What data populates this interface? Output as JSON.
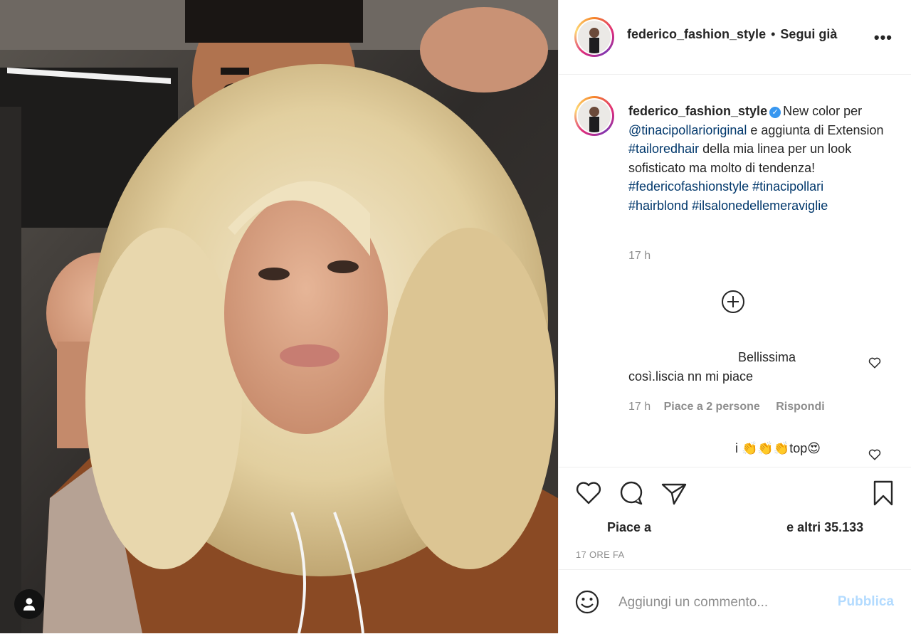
{
  "post": {
    "username": "federico_fashion_style",
    "follow_status": "Segui già",
    "header_separator": "•",
    "more_label": "•••"
  },
  "caption": {
    "username": "federico_fashion_style",
    "text_1": "New color per ",
    "mention": "@tinacipollarioriginal",
    "text_2": " e aggiunta di Extension ",
    "hashtag_1": "#tailoredhair",
    "text_3": " della mia linea per un look sofisticato ma molto di tendenza! ",
    "hashtag_2": "#federicofashionstyle",
    "hashtag_3": "#tinacipollari",
    "hashtag_4": "#hairblond",
    "hashtag_5": "#ilsalonedellemeraviglie",
    "time": "17 h"
  },
  "comments": [
    {
      "line1": "Bellissima",
      "line2": "così.liscia nn mi piace",
      "time": "17 h",
      "likes": "Piace a 2 persone",
      "reply": "Rispondi"
    },
    {
      "text": "i 👏👏👏top😍"
    }
  ],
  "likes": {
    "prefix": "Piace a",
    "suffix": "e altri 35.133"
  },
  "timestamp": "17 ORE FA",
  "add_comment": {
    "placeholder": "Aggiungi un commento...",
    "publish_label": "Pubblica"
  },
  "colors": {
    "link": "#00376b",
    "secondary_text": "#8e8e8e",
    "publish_disabled": "#b3dbff",
    "verified": "#3897f0"
  }
}
